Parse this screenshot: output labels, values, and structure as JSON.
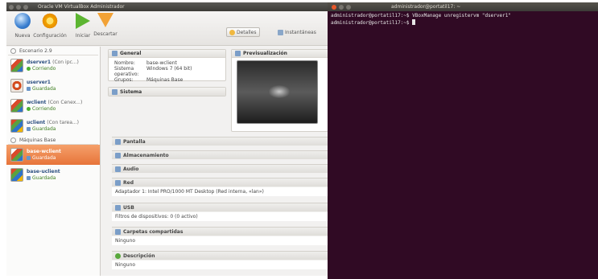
{
  "vbox": {
    "title": "Oracle VM VirtualBox Administrador",
    "toolbar": {
      "nueva": "Nueva",
      "configuracion": "Configuración",
      "iniciar": "Iniciar",
      "descartar": "Descartar",
      "detalles": "Detalles",
      "instantaneas": "Instantáneas"
    },
    "groups": [
      {
        "name": "Escenario 2.9",
        "vms": [
          {
            "name": "dserver1",
            "extra": "(Con ipc...)",
            "state": "Corriendo",
            "os": "windows"
          },
          {
            "name": "userver1",
            "extra": "",
            "state": "Guardada",
            "os": "ubuntu"
          },
          {
            "name": "wclient",
            "extra": "(Con Cenex...)",
            "state": "Corriendo",
            "os": "windows"
          },
          {
            "name": "uclient",
            "extra": "(Con tarea...)",
            "state": "Guardada",
            "os": "ubuntu"
          }
        ]
      },
      {
        "name": "Máquinas Base",
        "vms": [
          {
            "name": "base-wclient",
            "extra": "",
            "state": "Guardada",
            "os": "windows",
            "selected": true
          },
          {
            "name": "base-uclient",
            "extra": "",
            "state": "Guardada",
            "os": "ubuntu"
          }
        ]
      }
    ],
    "general": {
      "title": "General",
      "rows": [
        {
          "k": "Nombre:",
          "v": "base-wclient"
        },
        {
          "k": "Sistema operativo:",
          "v": "Windows 7 (64 bit)"
        },
        {
          "k": "Grupos:",
          "v": "Máquinas Base"
        }
      ]
    },
    "preview_title": "Previsualización",
    "sistema_title": "Sistema",
    "sections": {
      "pantalla": "Pantalla",
      "almacenamiento": "Almacenamiento",
      "audio": "Audio",
      "red": "Red",
      "red_row": "Adaptador 1:  Intel PRO/1000 MT Desktop (Red interna, «lan»)",
      "usb": "USB",
      "usb_row": "Filtros de dispositivos:  0 (0 activo)",
      "carpetas": "Carpetas compartidas",
      "carpetas_row": "Ninguno",
      "descripcion": "Descripción",
      "descripcion_row": "Ninguno"
    }
  },
  "terminal": {
    "title": "administrador@portatil17: ~",
    "lines": [
      "administrador@portatil17:~$ VBoxManage unregistervm \"dserver1\"",
      "administrador@portatil17:~$ "
    ]
  },
  "colors": {
    "terminal_bg": "#300a24",
    "selected_vm": "#e7743a"
  }
}
